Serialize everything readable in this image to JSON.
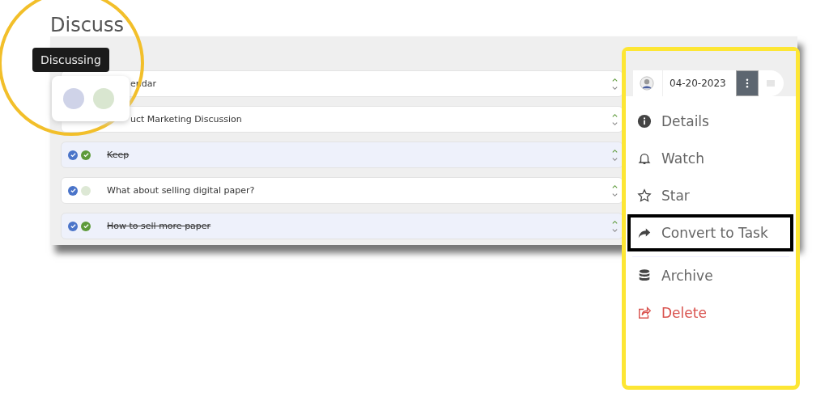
{
  "title": "Discuss",
  "rows": [
    {
      "kind": "partial",
      "text": "endar",
      "done": false,
      "dots": []
    },
    {
      "kind": "partial",
      "text": "uct Marketing Discussion",
      "done": false,
      "dots": []
    },
    {
      "kind": "full",
      "text": "Keep",
      "done": true,
      "dots": [
        {
          "checked": true,
          "color": "#4a74c9"
        },
        {
          "checked": true,
          "color": "#5d9a3a"
        }
      ]
    },
    {
      "kind": "full",
      "text": "What about selling digital paper?",
      "done": false,
      "dots": [
        {
          "checked": true,
          "color": "#4a74c9"
        },
        {
          "checked": false
        }
      ]
    },
    {
      "kind": "full",
      "text": "How to sell more paper",
      "done": true,
      "dots": [
        {
          "checked": true,
          "color": "#4a74c9"
        },
        {
          "checked": true,
          "color": "#5d9a3a"
        }
      ]
    }
  ],
  "magnifier": {
    "tooltip": "Discussing",
    "dots": [
      {
        "checked": false
      },
      {
        "checked": false
      }
    ]
  },
  "menu": {
    "date": "04-20-2023",
    "more_open": true,
    "items": [
      {
        "kind": "info",
        "label": "Details",
        "highlighted": false
      },
      {
        "kind": "bell",
        "label": "Watch",
        "highlighted": false
      },
      {
        "kind": "star",
        "label": "Star",
        "highlighted": false
      },
      {
        "kind": "share",
        "label": "Convert to Task",
        "highlighted": true
      },
      {
        "kind": "archive",
        "label": "Archive",
        "highlighted": false
      },
      {
        "kind": "delete",
        "label": "Delete",
        "highlighted": false
      }
    ]
  }
}
